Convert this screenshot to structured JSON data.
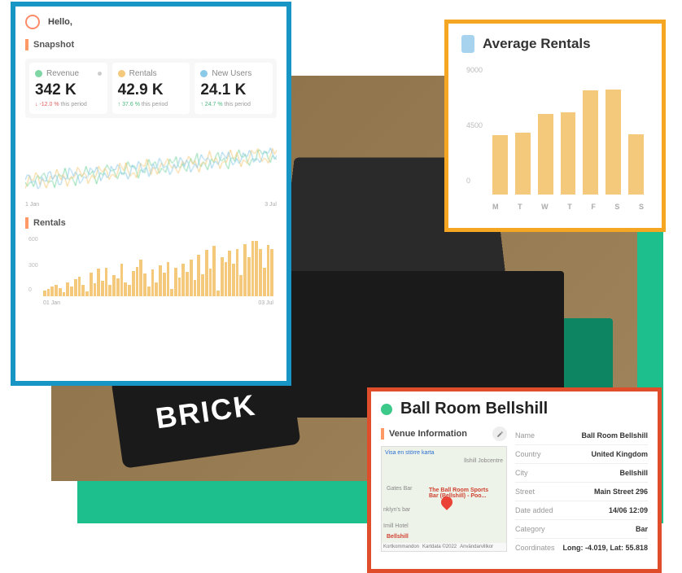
{
  "greeting": "Hello,",
  "snapshot": {
    "title": "Snapshot",
    "metrics": [
      {
        "label": "Revenue",
        "value": "342 K",
        "delta": "-12.0 %",
        "trend": "down",
        "period": "this period"
      },
      {
        "label": "Rentals",
        "value": "42.9 K",
        "delta": "37.6 %",
        "trend": "up",
        "period": "this period"
      },
      {
        "label": "New Users",
        "value": "24.1 K",
        "delta": "24.7 %",
        "trend": "up",
        "period": "this period"
      }
    ],
    "dateStart": "1 Jan",
    "dateEnd": "3 Jul"
  },
  "rentals_section": {
    "title": "Rentals",
    "yticks": [
      "600",
      "300",
      "0"
    ],
    "dateStart": "01 Jan",
    "dateEnd": "03 Jul"
  },
  "avg_rentals": {
    "title": "Average Rentals"
  },
  "chart_data": [
    {
      "type": "bar",
      "title": "Average Rentals",
      "categories": [
        "M",
        "T",
        "W",
        "T",
        "F",
        "S",
        "S"
      ],
      "values": [
        4600,
        4800,
        6300,
        6400,
        8100,
        8200,
        4700
      ],
      "yticks": [
        0,
        4500,
        9000
      ],
      "ylim": [
        0,
        9000
      ]
    },
    {
      "type": "bar",
      "title": "Rentals",
      "xlabel_start": "01 Jan",
      "xlabel_end": "03 Jul",
      "ylim": [
        0,
        600
      ],
      "yticks": [
        0,
        300,
        600
      ],
      "values": [
        60,
        80,
        100,
        120,
        90,
        40,
        150,
        100,
        180,
        210,
        120,
        50,
        250,
        140,
        290,
        160,
        300,
        120,
        220,
        190,
        340,
        150,
        120,
        270,
        310,
        390,
        240,
        100,
        280,
        150,
        330,
        250,
        360,
        80,
        300,
        200,
        340,
        260,
        390,
        170,
        440,
        230,
        490,
        290,
        530,
        60,
        410,
        360,
        480,
        340,
        500,
        220,
        550,
        410,
        580,
        580,
        500,
        300,
        540,
        500
      ]
    },
    {
      "type": "line",
      "title": "Snapshot trend",
      "series": [
        {
          "name": "Revenue",
          "color": "#7ed6a5"
        },
        {
          "name": "Rentals",
          "color": "#f5c97b"
        },
        {
          "name": "New Users",
          "color": "#8bc9e8"
        }
      ],
      "xlabel_start": "1 Jan",
      "xlabel_end": "3 Jul"
    }
  ],
  "venue": {
    "title": "Ball Room Bellshill",
    "info_heading": "Venue Information",
    "fields": [
      {
        "label": "Name",
        "value": "Ball Room Bellshill"
      },
      {
        "label": "Country",
        "value": "United Kingdom"
      },
      {
        "label": "City",
        "value": "Bellshill"
      },
      {
        "label": "Street",
        "value": "Main Street 296"
      },
      {
        "label": "Date added",
        "value": "14/06 12:09"
      },
      {
        "label": "Category",
        "value": "Bar"
      },
      {
        "label": "Coordinates",
        "value": "Long: -4.019, Lat: 55.818"
      }
    ],
    "map": {
      "link": "Visa en större karta",
      "place": "The Ball Room Sports Bar (Bellshill) - Poo...",
      "nearby1": "Gates Bar",
      "nearby2": "nklyn's bar",
      "nearby3": "Imill Hotel",
      "nearby4": "llshill Jobcentre",
      "town": "Bellshill",
      "footer1": "Kortkommandon",
      "footer2": "Kartdata ©2022",
      "footer3": "Användarvillkor"
    }
  },
  "brand": "BRICK"
}
